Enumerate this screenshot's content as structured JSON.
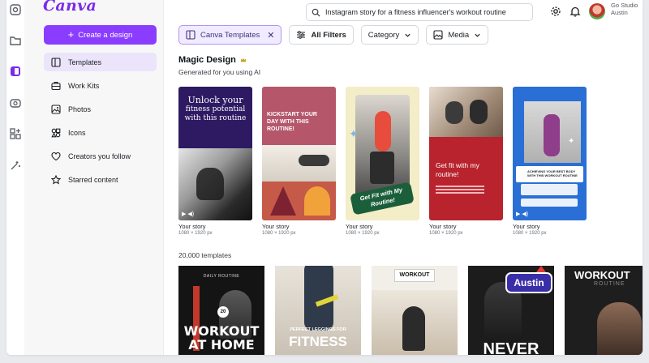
{
  "app": {
    "logo": "Canva"
  },
  "sidebar": {
    "create_label": "Create a design",
    "items": [
      {
        "label": "Templates",
        "icon": "template-icon",
        "active": true
      },
      {
        "label": "Work Kits",
        "icon": "briefcase-icon",
        "active": false
      },
      {
        "label": "Photos",
        "icon": "photo-icon",
        "active": false
      },
      {
        "label": "Icons",
        "icon": "shapes-icon",
        "active": false
      },
      {
        "label": "Creators you follow",
        "icon": "heart-icon",
        "active": false
      },
      {
        "label": "Starred content",
        "icon": "star-icon",
        "active": false
      }
    ]
  },
  "header": {
    "search_value": "Instagram story for a fitness influencer's workout routine",
    "user_name_partial": "Go Studio",
    "user_sub": "Austin"
  },
  "filters": {
    "selected_chip": "Canva Templates",
    "all_filters": "All Filters",
    "category": "Category",
    "media": "Media"
  },
  "magic": {
    "title": "Magic Design",
    "subtitle": "Generated for you using AI",
    "cards": [
      {
        "title": "Your story",
        "dims": "1080 × 1920 px",
        "text": [
          "Unlock your",
          "fitness potential",
          "with this routine"
        ]
      },
      {
        "title": "Your story",
        "dims": "1080 × 1920 px",
        "text": [
          "KICKSTART YOUR",
          "DAY WITH THIS",
          "ROUTINE!"
        ]
      },
      {
        "title": "Your story",
        "dims": "1080 × 1920 px",
        "text": [
          "Get Fit with My",
          "Routine!"
        ]
      },
      {
        "title": "Your story",
        "dims": "1080 × 1920 px",
        "text": [
          "Get fit with my",
          "routine!"
        ]
      },
      {
        "title": "Your story",
        "dims": "1080 × 1920 px",
        "text": [
          "ACHIEVING YOUR BEST BODY",
          "WITH THIS WORKOUT ROUTINE"
        ]
      }
    ]
  },
  "templates": {
    "count_label": "20,000 templates",
    "tiles": [
      {
        "top": "DAILY ROUTINE",
        "main": [
          "WORKOUT",
          "AT HOME"
        ]
      },
      {
        "top": "PERFECT LEGGINGS FOR",
        "main": [
          "FITNESS"
        ]
      },
      {
        "top": "WORKOUT",
        "main": []
      },
      {
        "top": "Austin",
        "main": [
          "NEVER"
        ]
      },
      {
        "top": "WORKOUT",
        "main": [
          "ROUTINE"
        ]
      }
    ]
  },
  "colors": {
    "brand": "#8b3dff",
    "logo": "#7d2ae8"
  }
}
